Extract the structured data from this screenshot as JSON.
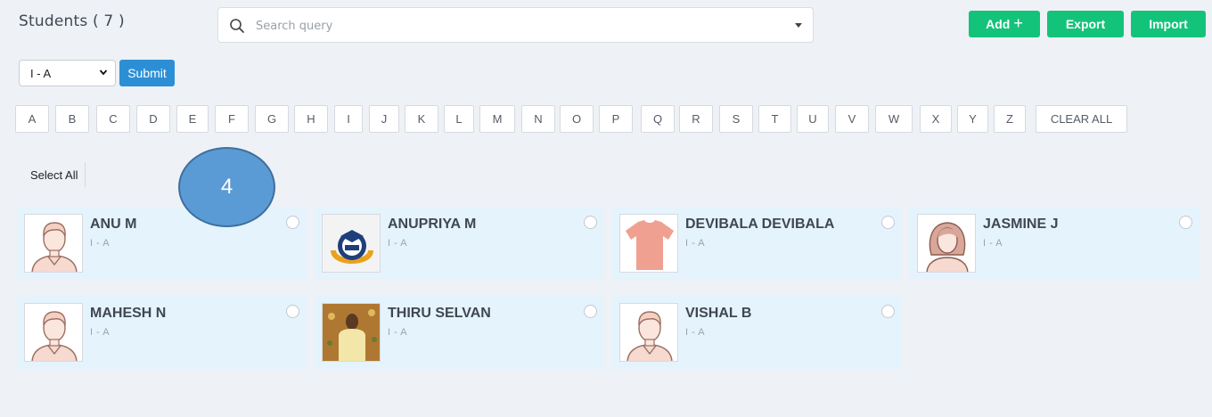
{
  "header": {
    "title": "Students ( 7 )",
    "search_placeholder": "Search query",
    "add_label": "Add",
    "export_label": "Export",
    "import_label": "Import"
  },
  "filter": {
    "class_selected": "I - A",
    "submit_label": "Submit"
  },
  "alphabet": [
    "A",
    "B",
    "C",
    "D",
    "E",
    "F",
    "G",
    "H",
    "I",
    "J",
    "K",
    "L",
    "M",
    "N",
    "O",
    "P",
    "Q",
    "R",
    "S",
    "T",
    "U",
    "V",
    "W",
    "X",
    "Y",
    "Z"
  ],
  "clear_all_label": "CLEAR ALL",
  "select_all_label": "Select All",
  "badge_label": "4",
  "students": [
    {
      "name": "ANU M",
      "class": "I - A",
      "avatar": "male-avatar-icon"
    },
    {
      "name": "ANUPRIYA M",
      "class": "I - A",
      "avatar": "school-logo-icon"
    },
    {
      "name": "DEVIBALA DEVIBALA",
      "class": "I - A",
      "avatar": "tshirt-icon"
    },
    {
      "name": "JASMINE J",
      "class": "I - A",
      "avatar": "female-avatar-icon"
    },
    {
      "name": "MAHESH N",
      "class": "I - A",
      "avatar": "male-avatar-icon"
    },
    {
      "name": "THIRU SELVAN",
      "class": "I - A",
      "avatar": "student-photo"
    },
    {
      "name": "VISHAL B",
      "class": "I - A",
      "avatar": "male-avatar-icon"
    }
  ],
  "colors": {
    "green": "#14c37a",
    "blue": "#2c8fd6",
    "card_bg": "#e5f3fd",
    "badge": "#5b9bd5"
  }
}
